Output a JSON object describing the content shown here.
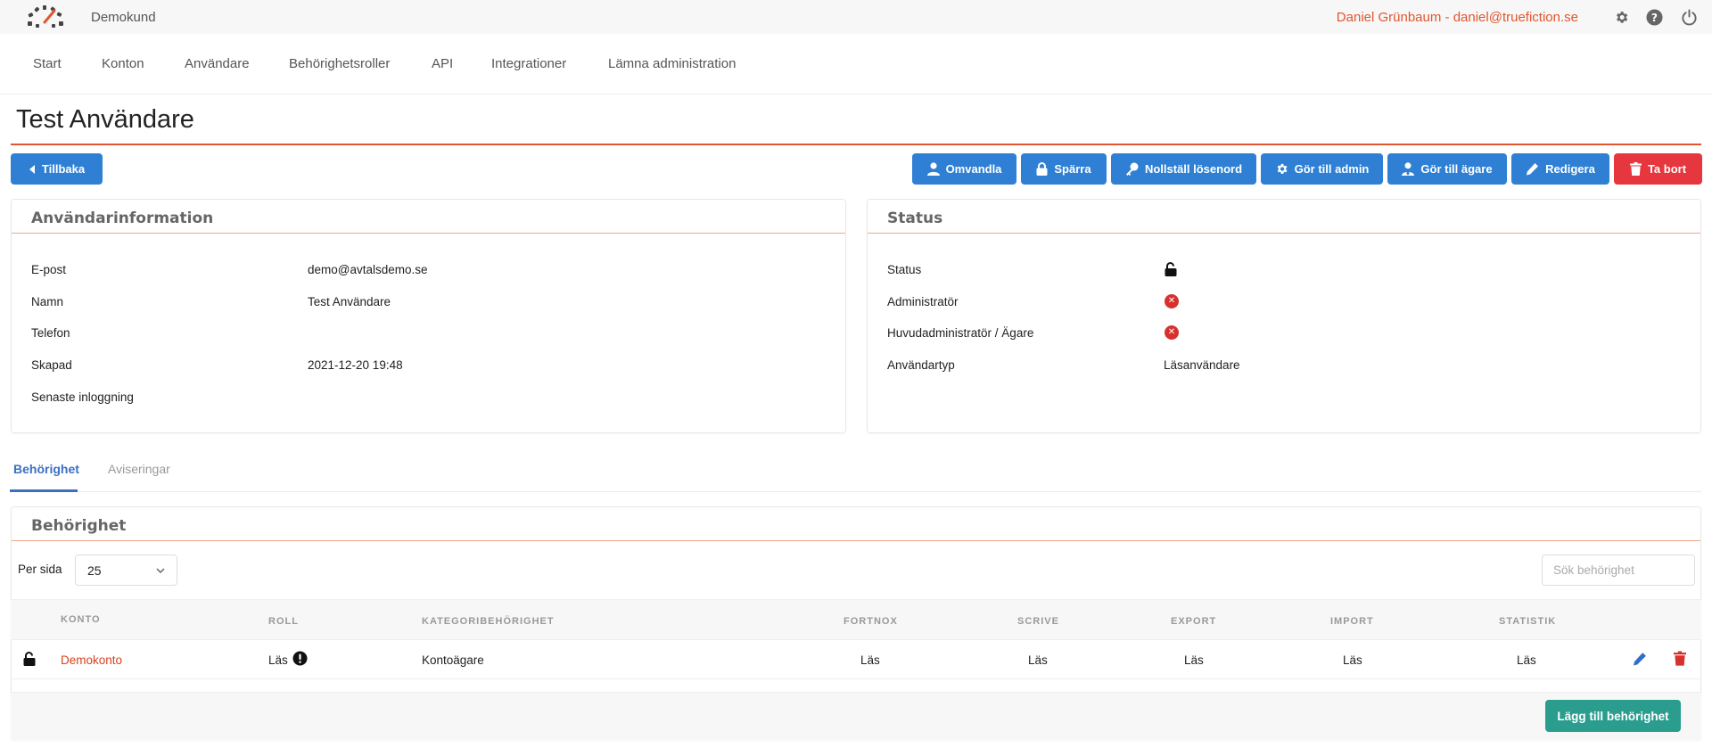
{
  "topbar": {
    "brand": "Demokund",
    "user": "Daniel Grünbaum - daniel@truefiction.se",
    "icons": [
      "gear-icon",
      "help-icon",
      "power-icon"
    ]
  },
  "nav": {
    "items": [
      "Start",
      "Konton",
      "Användare",
      "Behörighetsroller",
      "API",
      "Integrationer",
      "Lämna administration"
    ]
  },
  "page": {
    "title": "Test Användare"
  },
  "actions": {
    "back": "Tillbaka",
    "impersonate": "Omvandla",
    "lock": "Spärra",
    "reset_password": "Nollställ lösenord",
    "make_admin": "Gör till admin",
    "make_owner": "Gör till ägare",
    "edit": "Redigera",
    "delete": "Ta bort"
  },
  "user_info": {
    "title": "Användarinformation",
    "rows": [
      {
        "label": "E-post",
        "value": "demo@avtalsdemo.se"
      },
      {
        "label": "Namn",
        "value": "Test Användare"
      },
      {
        "label": "Telefon",
        "value": ""
      },
      {
        "label": "Skapad",
        "value": "2021-12-20 19:48"
      },
      {
        "label": "Senaste inloggning",
        "value": ""
      }
    ]
  },
  "status": {
    "title": "Status",
    "rows": [
      {
        "label": "Status",
        "icon": "unlock-icon"
      },
      {
        "label": "Administratör",
        "icon": "x-circle-icon"
      },
      {
        "label": "Huvudadministratör / Ägare",
        "icon": "x-circle-icon"
      },
      {
        "label": "Användartyp",
        "value": "Läsanvändare"
      }
    ]
  },
  "tabs": {
    "items": [
      "Behörighet",
      "Aviseringar"
    ],
    "active": "Behörighet"
  },
  "permissions": {
    "title": "Behörighet",
    "per_page_label": "Per sida",
    "per_page_value": "25",
    "search_placeholder": "Sök behörighet",
    "columns": [
      "KONTO",
      "ROLL",
      "KATEGORIBEHÖRIGHET",
      "FORTNOX",
      "SCRIVE",
      "EXPORT",
      "IMPORT",
      "STATISTIK"
    ],
    "rows": [
      {
        "account": "Demokonto",
        "role": "Läs",
        "category": "Kontoägare",
        "fortnox": "Läs",
        "scrive": "Läs",
        "export": "Läs",
        "import": "Läs",
        "statistik": "Läs"
      }
    ],
    "add_button": "Lägg till behörighet"
  },
  "colors": {
    "accent": "#e0562e",
    "primary": "#2f80d4",
    "danger": "#e5373d",
    "teal": "#2a9d8f"
  }
}
